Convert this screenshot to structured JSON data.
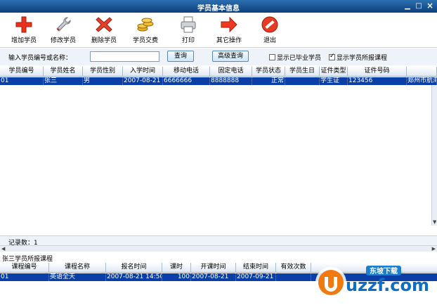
{
  "window": {
    "title": "学员基本信息",
    "minimize": "▁",
    "restore": "□",
    "close": "×"
  },
  "toolbar": {
    "add": "增加学员",
    "edit": "修改学员",
    "delete": "删除学员",
    "payment": "学员交费",
    "print": "打印",
    "other": "其它操作",
    "exit": "退出"
  },
  "search": {
    "label": "输入学员编号或名称：",
    "value": "",
    "query_button": "查询",
    "advanced_button": "高级查询",
    "show_graduated": "显示已毕业学员",
    "show_graduated_checked": false,
    "show_courses": "显示学员所报课程",
    "show_courses_checked": true
  },
  "students": {
    "columns": [
      "学员编号",
      "学员姓名",
      "学员性别",
      "入学时间",
      "移动电话",
      "固定电话",
      "学员状态",
      "学员生日",
      "证件类型",
      "证件号码",
      ""
    ],
    "rows": [
      [
        "01",
        "张三",
        "男",
        "2007-08-21",
        "6666666",
        "8888888",
        "正常",
        "",
        "学生证",
        "123456",
        "郑州市航海"
      ]
    ]
  },
  "status": {
    "record_count": "记录数：1"
  },
  "courses": {
    "title": "张三学员所报课程",
    "columns": [
      "课程编号",
      "课程名称",
      "报名时间",
      "课时",
      "开课时间",
      "结束时间",
      "有效次数"
    ],
    "rows": [
      [
        "01",
        "英语全天",
        "2007-08-21 14:50",
        "100",
        "2007-08-21",
        "2007-09-21",
        ""
      ]
    ]
  },
  "watermark": {
    "text": "uzzf.com",
    "tagline": "东坡下载"
  }
}
